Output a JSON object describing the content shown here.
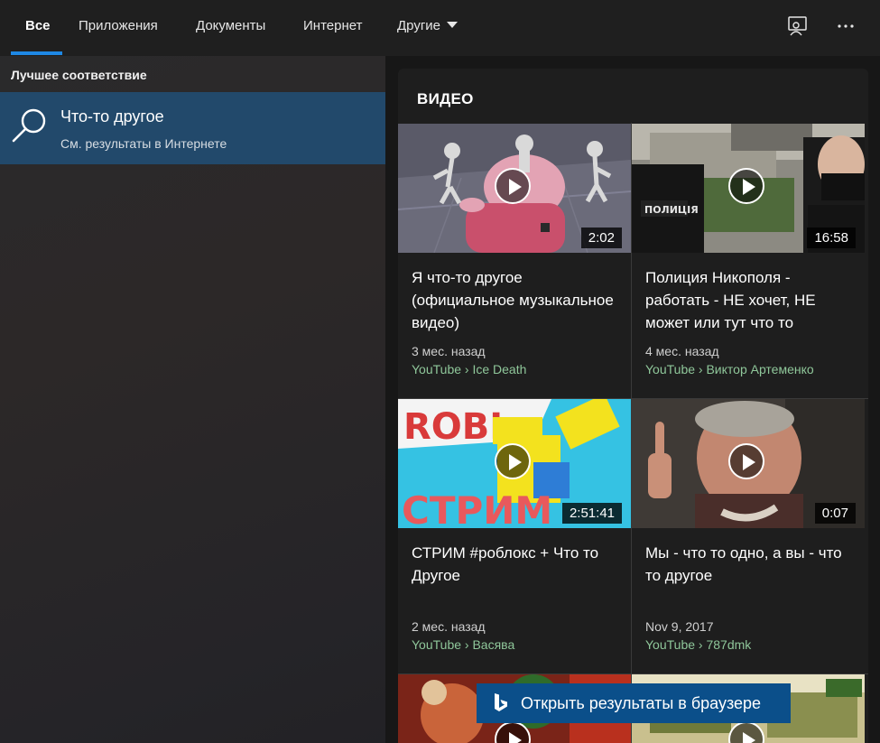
{
  "tabs": [
    {
      "label": "Все"
    },
    {
      "label": "Приложения"
    },
    {
      "label": "Документы"
    },
    {
      "label": "Интернет"
    },
    {
      "label": "Другие"
    }
  ],
  "left": {
    "section_title": "Лучшее соответствие",
    "best_match": {
      "title": "Что-то другое",
      "subtitle": "См. результаты в Интернете"
    }
  },
  "videos_section": {
    "heading": "ВИДЕО",
    "items": [
      {
        "title": "Я что-то другое (официальное музыкальное видео)",
        "duration": "2:02",
        "age": "3 мес. назад",
        "source": "YouTube › Ice Death"
      },
      {
        "title": "Полиция Никополя - работать - НЕ хочет, НЕ может или тут что то",
        "duration": "16:58",
        "age": "4 мес. назад",
        "source": "YouTube › Виктор Артеменко"
      },
      {
        "title": "СТРИМ #роблокс + Что то Другое",
        "duration": "2:51:41",
        "age": "2 мес. назад",
        "source": "YouTube › Васява"
      },
      {
        "title": "Мы - что то одно, а вы - что то другое",
        "duration": "0:07",
        "age": "Nov 9, 2017",
        "source": "YouTube › 787dmk"
      }
    ]
  },
  "open_browser_label": "Открыть результаты в браузере",
  "colors": {
    "accent": "#1e88e5",
    "best_match_bg": "#22496b",
    "source_green": "#8fc79a",
    "browser_button": "#0b4f8a"
  }
}
